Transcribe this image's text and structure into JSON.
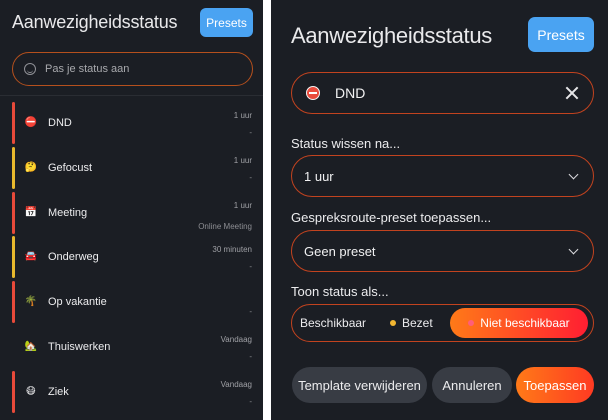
{
  "left": {
    "title": "Aanwezigheidsstatus",
    "presets_label": "Presets",
    "search_placeholder": "Pas je status aan",
    "items": [
      {
        "name": "DND",
        "emoji": "⛔",
        "duration": "1 uur",
        "detail": "-",
        "bar_color": "#e84a3a"
      },
      {
        "name": "Gefocust",
        "emoji": "🤔",
        "duration": "1 uur",
        "detail": "-",
        "bar_color": "#e8b92d"
      },
      {
        "name": "Meeting",
        "emoji": "📅",
        "duration": "1 uur",
        "detail": "Online Meeting",
        "bar_color": "#e84a3a"
      },
      {
        "name": "Onderweg",
        "emoji": "🚘",
        "duration": "30 minuten",
        "detail": "-",
        "bar_color": "#e8b92d"
      },
      {
        "name": "Op vakantie",
        "emoji": "🌴",
        "duration": "",
        "detail": "-",
        "bar_color": "#e84a3a"
      },
      {
        "name": "Thuiswerken",
        "emoji": "🏡",
        "duration": "Vandaag",
        "detail": "-",
        "bar_color": ""
      },
      {
        "name": "Ziek",
        "emoji": "😷",
        "duration": "Vandaag",
        "detail": "-",
        "bar_color": "#e84a3a"
      }
    ]
  },
  "right": {
    "title": "Aanwezigheidsstatus",
    "presets_label": "Presets",
    "selected_status": "DND",
    "clear_label": "Status wissen na...",
    "clear_value": "1 uur",
    "route_label": "Gespreksroute-preset toepassen...",
    "route_value": "Geen preset",
    "show_label": "Toon status als...",
    "show_options": [
      "Beschikbaar",
      "Bezet",
      "Niet beschikbaar"
    ],
    "selected_show": "Niet beschikbaar",
    "buttons": {
      "remove": "Template verwijderen",
      "cancel": "Annuleren",
      "apply": "Toepassen"
    }
  },
  "colors": {
    "accent_blue": "#4aa3f2",
    "accent_orange": "#ff7a18",
    "accent_red": "#ff1e32",
    "border_orange": "#c2431f",
    "background": "#1b1e24"
  }
}
